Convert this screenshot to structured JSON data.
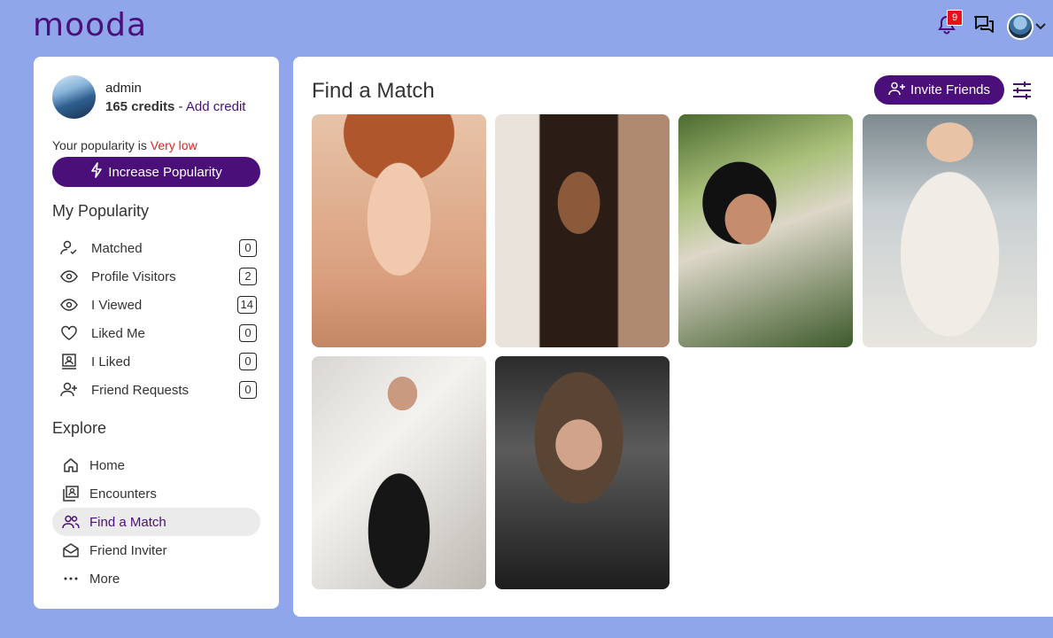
{
  "brand": {
    "logo": "mooda",
    "accent": "#4b0f7a",
    "background": "#8fa7ea"
  },
  "topbar": {
    "notification_count": "9",
    "icons": [
      "bell-icon",
      "chat-icon",
      "avatar",
      "chevron-down-icon"
    ]
  },
  "sidebar": {
    "user_name": "admin",
    "credits": "165 credits",
    "separator": " - ",
    "add_credit": "Add credit",
    "popularity_prefix": "Your popularity is ",
    "popularity_value": "Very low",
    "increase_label": "Increase Popularity",
    "my_popularity_title": "My Popularity",
    "popularity_items": [
      {
        "label": "Matched",
        "count": "0",
        "icon": "user-check-icon"
      },
      {
        "label": "Profile Visitors",
        "count": "2",
        "icon": "eye-icon"
      },
      {
        "label": "I Viewed",
        "count": "14",
        "icon": "eye-icon"
      },
      {
        "label": "Liked Me",
        "count": "0",
        "icon": "heart-icon"
      },
      {
        "label": "I Liked",
        "count": "0",
        "icon": "portrait-icon"
      },
      {
        "label": "Friend Requests",
        "count": "0",
        "icon": "user-plus-icon"
      }
    ],
    "explore_title": "Explore",
    "explore_items": [
      {
        "label": "Home",
        "icon": "home-icon"
      },
      {
        "label": "Encounters",
        "icon": "encounters-icon"
      },
      {
        "label": "Find a Match",
        "icon": "users-icon",
        "active": true
      },
      {
        "label": "Friend Inviter",
        "icon": "envelope-icon"
      },
      {
        "label": "More",
        "icon": "more-icon"
      }
    ]
  },
  "main": {
    "title": "Find a Match",
    "invite_label": "Invite Friends",
    "photos": [
      {
        "name": "profile-photo-1"
      },
      {
        "name": "profile-photo-2"
      },
      {
        "name": "profile-photo-3"
      },
      {
        "name": "profile-photo-4"
      },
      {
        "name": "profile-photo-5"
      },
      {
        "name": "profile-photo-6"
      }
    ]
  }
}
